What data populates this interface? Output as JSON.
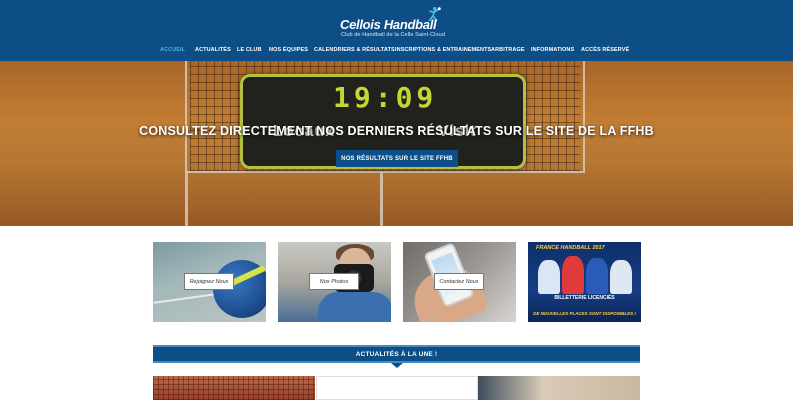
{
  "header": {
    "logo_title": "Cellois Handball",
    "logo_subtitle": "Club de Handball de la Celle Saint-Cloud",
    "brand_color": "#0d4e86"
  },
  "nav": {
    "items": [
      {
        "label": "ACCUEIL",
        "active": true
      },
      {
        "label": "ACTUALITÉS"
      },
      {
        "label": "LE CLUB"
      },
      {
        "label": "NOS ÉQUIPES"
      },
      {
        "label": "CALENDRIERS & RÉSULTATS"
      },
      {
        "label": "INSCRIPTIONS & ENTRAINEMENTS"
      },
      {
        "label": "ARBITRAGE"
      },
      {
        "label": "INFORMATIONS"
      },
      {
        "label": "ACCÈS RÉSERVÉ"
      }
    ]
  },
  "hero": {
    "scoreboard_time": "19:09",
    "scoreboard_home": "Locaux",
    "scoreboard_away": "Visit",
    "heading": "CONSULTEZ DIRECTEMENT NOS DERNIERS RÉSULTATS SUR LE SITE DE LA FFHB",
    "button_label": "NOS RÉSULTATS SUR LE SITE FFHB"
  },
  "tiles": [
    {
      "button_label": "Rejoignez Nous",
      "image": "handball-ball"
    },
    {
      "button_label": "Nos Photos",
      "image": "child-with-camera"
    },
    {
      "button_label": "Contactez Nous",
      "image": "hand-holding-phone"
    },
    {
      "image": "france-handball-ad",
      "brand": "FRANCE HANDBALL",
      "year": "2017",
      "ticket_text": "BILLETTERIE LICENCIÉS",
      "places_text": "DE NOUVELLES PLACES SONT DISPONIBLES !"
    }
  ],
  "news": {
    "section_title": "ACTUALITÉS À LA UNE !"
  }
}
